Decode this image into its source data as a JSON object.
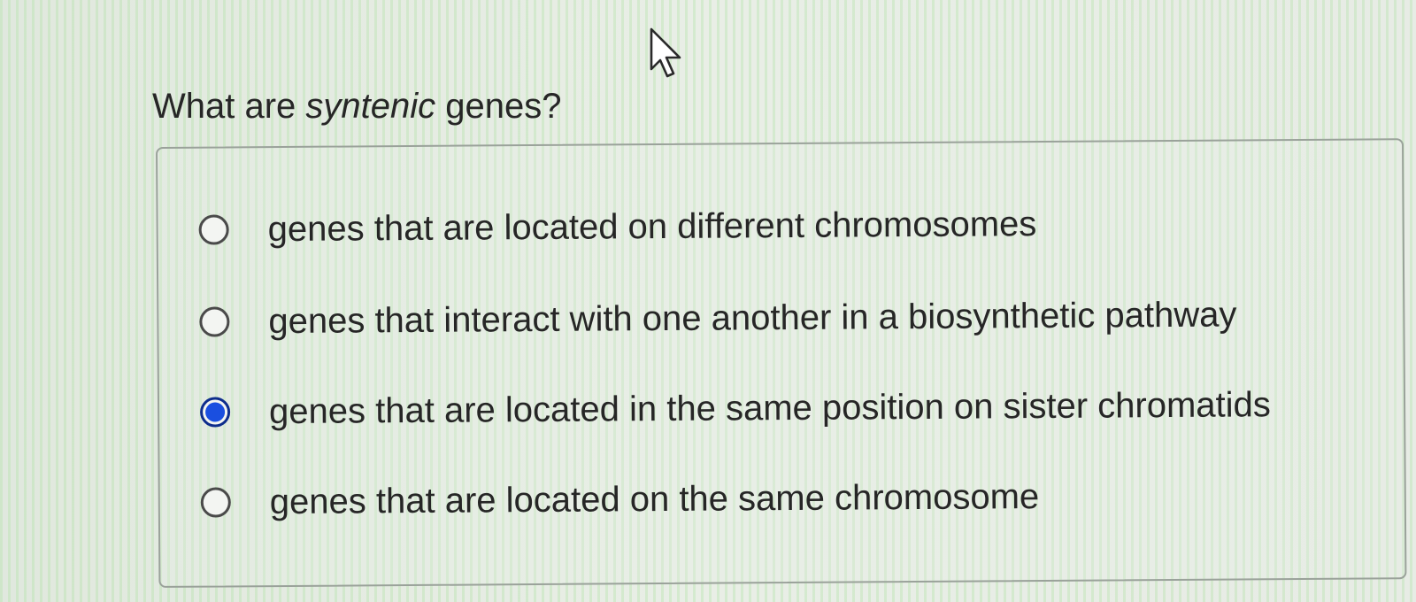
{
  "question": {
    "prefix": "What are ",
    "term": "syntenic",
    "suffix": " genes?"
  },
  "options": [
    {
      "label": "genes that are located on different chromosomes",
      "selected": false
    },
    {
      "label": "genes that interact with one another in a biosynthetic pathway",
      "selected": false
    },
    {
      "label": "genes that are located in the same position on sister chromatids",
      "selected": true
    },
    {
      "label": "genes that are located on the same chromosome",
      "selected": false
    }
  ],
  "colors": {
    "selected_radio_fill": "#1a4fe0",
    "selected_radio_ring": "#0e2d8c"
  },
  "icons": {
    "cursor": "mouse-pointer-arrow-icon"
  }
}
